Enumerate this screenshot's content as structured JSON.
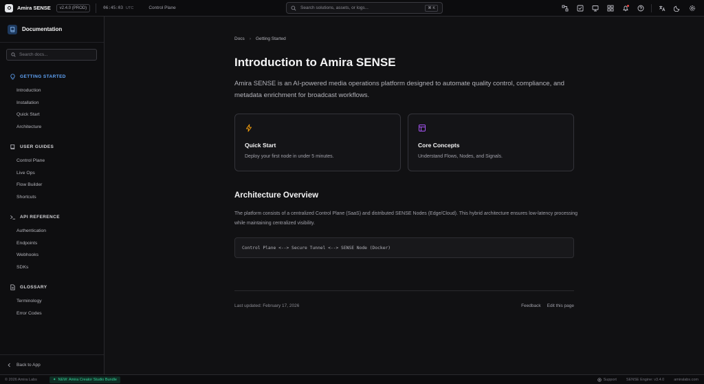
{
  "topbar": {
    "app_name": "Amira SENSE",
    "version": "v2.4.0 (PROD)",
    "time": "06:45:03",
    "timezone": "UTC",
    "context": "Control Plane",
    "search_placeholder": "Search solutions, assets, or logs...",
    "search_shortcut": "⌘ K",
    "icons": [
      "network-icon",
      "checklist-icon",
      "monitor-icon",
      "apps-icon",
      "notification-icon",
      "help-icon",
      "translate-icon",
      "theme-toggle-icon",
      "settings-icon"
    ]
  },
  "sidebar": {
    "title": "Documentation",
    "search_placeholder": "Search docs...",
    "sections": [
      {
        "title": "GETTING STARTED",
        "icon": "lightbulb-icon",
        "items": [
          "Introduction",
          "Installation",
          "Quick Start",
          "Architecture"
        ]
      },
      {
        "title": "USER GUIDES",
        "icon": "book-icon",
        "items": [
          "Control Plane",
          "Live Ops",
          "Flow Builder",
          "Shortcuts"
        ]
      },
      {
        "title": "API REFERENCE",
        "icon": "terminal-icon",
        "items": [
          "Authentication",
          "Endpoints",
          "Webhooks",
          "SDKs"
        ]
      },
      {
        "title": "GLOSSARY",
        "icon": "file-text-icon",
        "items": [
          "Terminology",
          "Error Codes"
        ]
      }
    ],
    "footer": "Back to App"
  },
  "main": {
    "breadcrumb": [
      "Docs",
      "Getting Started"
    ],
    "title": "Introduction to Amira SENSE",
    "lead": "Amira SENSE is an AI-powered media operations platform designed to automate quality control, compliance, and metadata enrichment for broadcast workflows.",
    "cards": [
      {
        "title": "Quick Start",
        "desc": "Deploy your first node in under 5 minutes.",
        "icon": "lightning-icon",
        "color": "#f59e0b"
      },
      {
        "title": "Core Concepts",
        "desc": "Understand Flows, Nodes, and Signals.",
        "icon": "layout-icon",
        "color": "#a855f7"
      }
    ],
    "section_title": "Architecture Overview",
    "section_text": "The platform consists of a centralized Control Plane (SaaS) and distributed SENSE Nodes (Edge/Cloud). This hybrid architecture ensures low-latency processing while maintaining centralized visibility.",
    "code": "Control Plane <--> Secure Tunnel <--> SENSE Node (Docker)",
    "last_updated": "Last updated: February 17, 2026",
    "footer_links": [
      "Feedback",
      "Edit this page"
    ]
  },
  "statusbar": {
    "copyright": "© 2026 Amira Labs",
    "promo": "NEW: Amira Creator Studio Bundle",
    "support": "Support",
    "engine": "SENSE Engine: v3.4.0",
    "domain": "amiralabs.com"
  },
  "colors": {
    "accent": "#60a5fa",
    "promo": "#34d399",
    "notification": "#ef4444"
  }
}
